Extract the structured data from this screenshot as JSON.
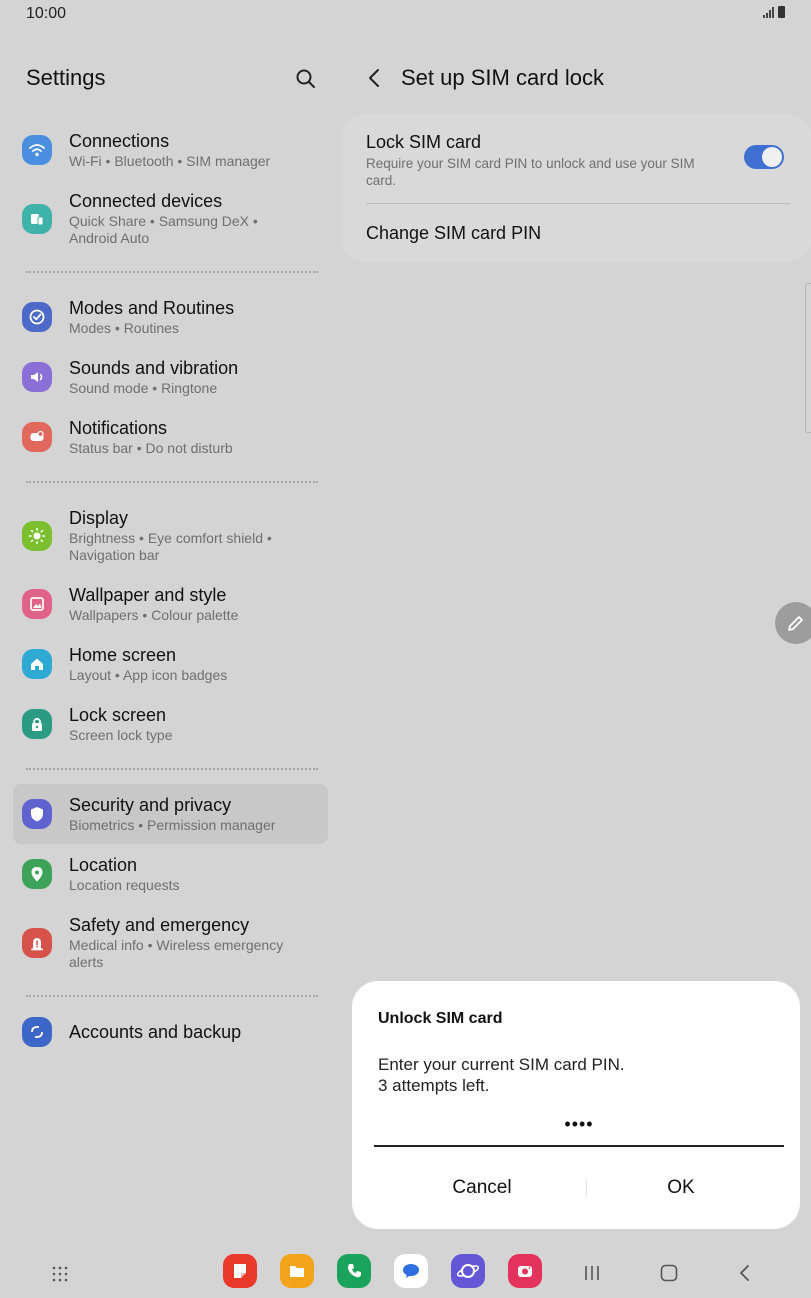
{
  "status": {
    "time": "10:00"
  },
  "settings": {
    "title": "Settings",
    "groups": [
      [
        {
          "title": "Connections",
          "subtitle": "Wi-Fi  •  Bluetooth  •  SIM manager",
          "icon": "wifi-icon",
          "color": "#4a8ee0"
        },
        {
          "title": "Connected devices",
          "subtitle": "Quick Share  •  Samsung DeX  •  Android Auto",
          "icon": "devices-icon",
          "color": "#3fb3a9"
        }
      ],
      [
        {
          "title": "Modes and Routines",
          "subtitle": "Modes  •  Routines",
          "icon": "check-circle-icon",
          "color": "#4d6ac9"
        },
        {
          "title": "Sounds and vibration",
          "subtitle": "Sound mode  •  Ringtone",
          "icon": "speaker-icon",
          "color": "#8a6fd6"
        },
        {
          "title": "Notifications",
          "subtitle": "Status bar  •  Do not disturb",
          "icon": "bell-icon",
          "color": "#e0685d"
        }
      ],
      [
        {
          "title": "Display",
          "subtitle": "Brightness  •  Eye comfort shield  •  Navigation bar",
          "icon": "sun-icon",
          "color": "#7cbf2e"
        },
        {
          "title": "Wallpaper and style",
          "subtitle": "Wallpapers  •  Colour palette",
          "icon": "image-icon",
          "color": "#e0628a"
        },
        {
          "title": "Home screen",
          "subtitle": "Layout  •  App icon badges",
          "icon": "home-icon",
          "color": "#2ea9d3"
        },
        {
          "title": "Lock screen",
          "subtitle": "Screen lock type",
          "icon": "lock-icon",
          "color": "#2c9b84"
        }
      ],
      [
        {
          "title": "Security and privacy",
          "subtitle": "Biometrics  •  Permission manager",
          "icon": "shield-icon",
          "color": "#5f62cf",
          "selected": true
        },
        {
          "title": "Location",
          "subtitle": "Location requests",
          "icon": "location-pin-icon",
          "color": "#3ea35a"
        },
        {
          "title": "Safety and emergency",
          "subtitle": "Medical info  •  Wireless emergency alerts",
          "icon": "alert-icon",
          "color": "#d6524a"
        }
      ],
      [
        {
          "title": "Accounts and backup",
          "subtitle": "",
          "icon": "sync-icon",
          "color": "#3c67c9"
        }
      ]
    ]
  },
  "sim_lock": {
    "title": "Set up SIM card lock",
    "lock_title": "Lock SIM card",
    "lock_subtitle": "Require your SIM card PIN to unlock and use your SIM card.",
    "lock_enabled": true,
    "change_pin": "Change SIM card PIN"
  },
  "dialog": {
    "title": "Unlock SIM card",
    "message_line1": "Enter your current SIM card PIN.",
    "message_line2": "3 attempts left.",
    "pin_value": "••••",
    "cancel": "Cancel",
    "ok": "OK"
  },
  "colors": {
    "accent": "#3f6fd1",
    "dialog_bg": "#ffffff",
    "dim_bg": "#d4d4d4"
  },
  "taskbar": {
    "apps": [
      {
        "icon": "notes-app-icon",
        "color": "#e8392b"
      },
      {
        "icon": "files-app-icon",
        "color": "#f4a41a"
      },
      {
        "icon": "phone-app-icon",
        "color": "#1aa35a"
      },
      {
        "icon": "messages-app-icon",
        "color": "#ffffff"
      },
      {
        "icon": "internet-app-icon",
        "color": "#6357d6"
      },
      {
        "icon": "camera-app-icon",
        "color": "#e3325b"
      }
    ]
  }
}
